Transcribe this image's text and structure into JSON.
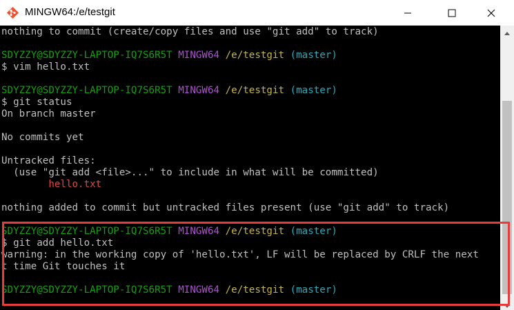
{
  "window": {
    "title": "MINGW64:/e/testgit",
    "icon": "git-bash-icon",
    "controls": [
      "minimize-icon",
      "maximize-icon",
      "close-icon"
    ]
  },
  "colors": {
    "terminal_bg": "#000000",
    "text": "#c0c0c0",
    "user_host": "#13a10e",
    "mingw": "#b04fd6",
    "path": "#c6b54a",
    "branch": "#2fa8b7",
    "untracked": "#e04848",
    "highlight": "#e83c3c"
  },
  "prompt": {
    "user_host": "SDYZZY@SDYZZY-LAPTOP-IQ7S6R5T",
    "system": "MINGW64",
    "path": "/e/testgit",
    "branch": "(master)"
  },
  "terminal": {
    "line_top": "nothing to commit (create/copy files and use \"git add\" to track)",
    "cmd_vim": "$ vim hello.txt",
    "cmd_status": "$ git status",
    "status_branch": "On branch master",
    "status_no_commits": "No commits yet",
    "status_untracked_header": "Untracked files:",
    "status_hint": "  (use \"git add <file>...\" to include in what will be committed)",
    "status_untracked_file": "        hello.txt",
    "status_summary": "nothing added to commit but untracked files present (use \"git add\" to track)",
    "cmd_add": "$ git add hello.txt",
    "warning_line1": "warning: in the working copy of 'hello.txt', LF will be replaced by CRLF the next",
    "warning_line2": "t time Git touches it"
  }
}
